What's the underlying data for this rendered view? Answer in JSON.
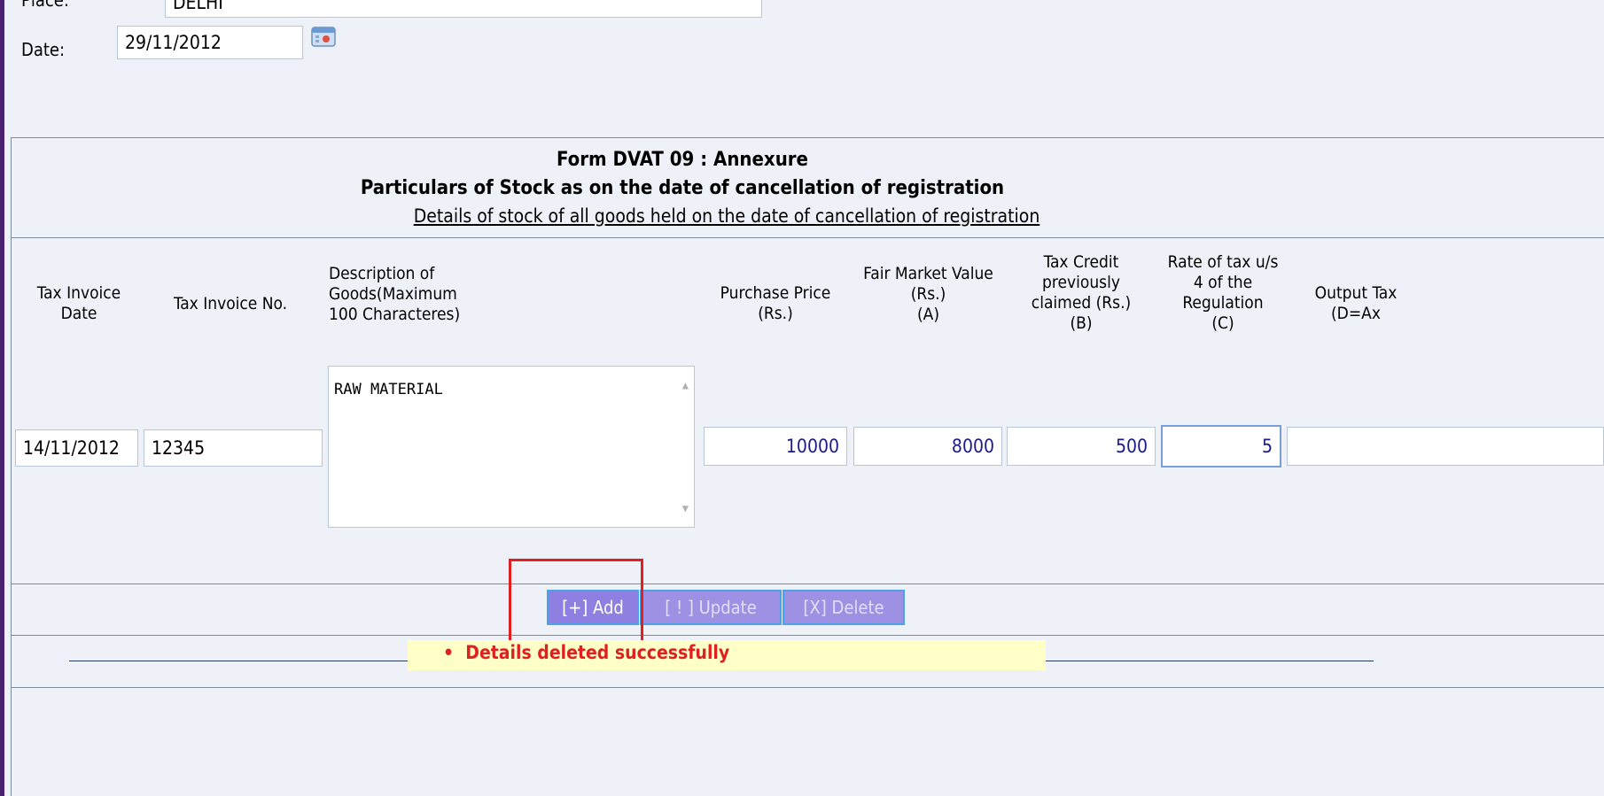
{
  "place": {
    "label": "Place:",
    "value": "DELHI"
  },
  "date": {
    "label": "Date:",
    "value": "29/11/2012"
  },
  "annexure": {
    "title": "Form DVAT 09 : Annexure",
    "subtitle": "Particulars of Stock as on the date of cancellation of registration",
    "caption": "Details of stock of all goods held on the date of cancellation of registration"
  },
  "table": {
    "headers": {
      "invoice_date": [
        "Tax Invoice",
        "Date"
      ],
      "invoice_no": [
        "Tax Invoice No."
      ],
      "description": [
        "Description of",
        "Goods(Maximum",
        "100 Characteres)"
      ],
      "purchase_price": [
        "Purchase Price",
        "(Rs.)"
      ],
      "fair_market_value": [
        "Fair Market Value",
        "(Rs.)",
        "(A)"
      ],
      "tax_credit": [
        "Tax Credit",
        "previously",
        "claimed (Rs.)",
        "(B)"
      ],
      "rate_of_tax": [
        "Rate of tax u/s",
        "4 of the",
        "Regulation",
        "(C)"
      ],
      "output_tax": [
        "Output Tax",
        "(D=Ax"
      ]
    },
    "row": {
      "invoice_date": "14/11/2012",
      "invoice_no": "12345",
      "description": "RAW MATERIAL",
      "purchase_price": "10000",
      "fair_market_value": "8000",
      "tax_credit": "500",
      "rate_of_tax": "5",
      "output_tax": ""
    }
  },
  "buttons": {
    "add": "[+] Add",
    "update": "[ ! ] Update",
    "delete": "[X] Delete"
  },
  "message": {
    "bullet": "•",
    "text": "Details deleted successfully"
  },
  "colors": {
    "accent_border": "#4a2070",
    "button": "#8f7fe0",
    "message_text": "#e02020",
    "highlight": "#e02020"
  }
}
